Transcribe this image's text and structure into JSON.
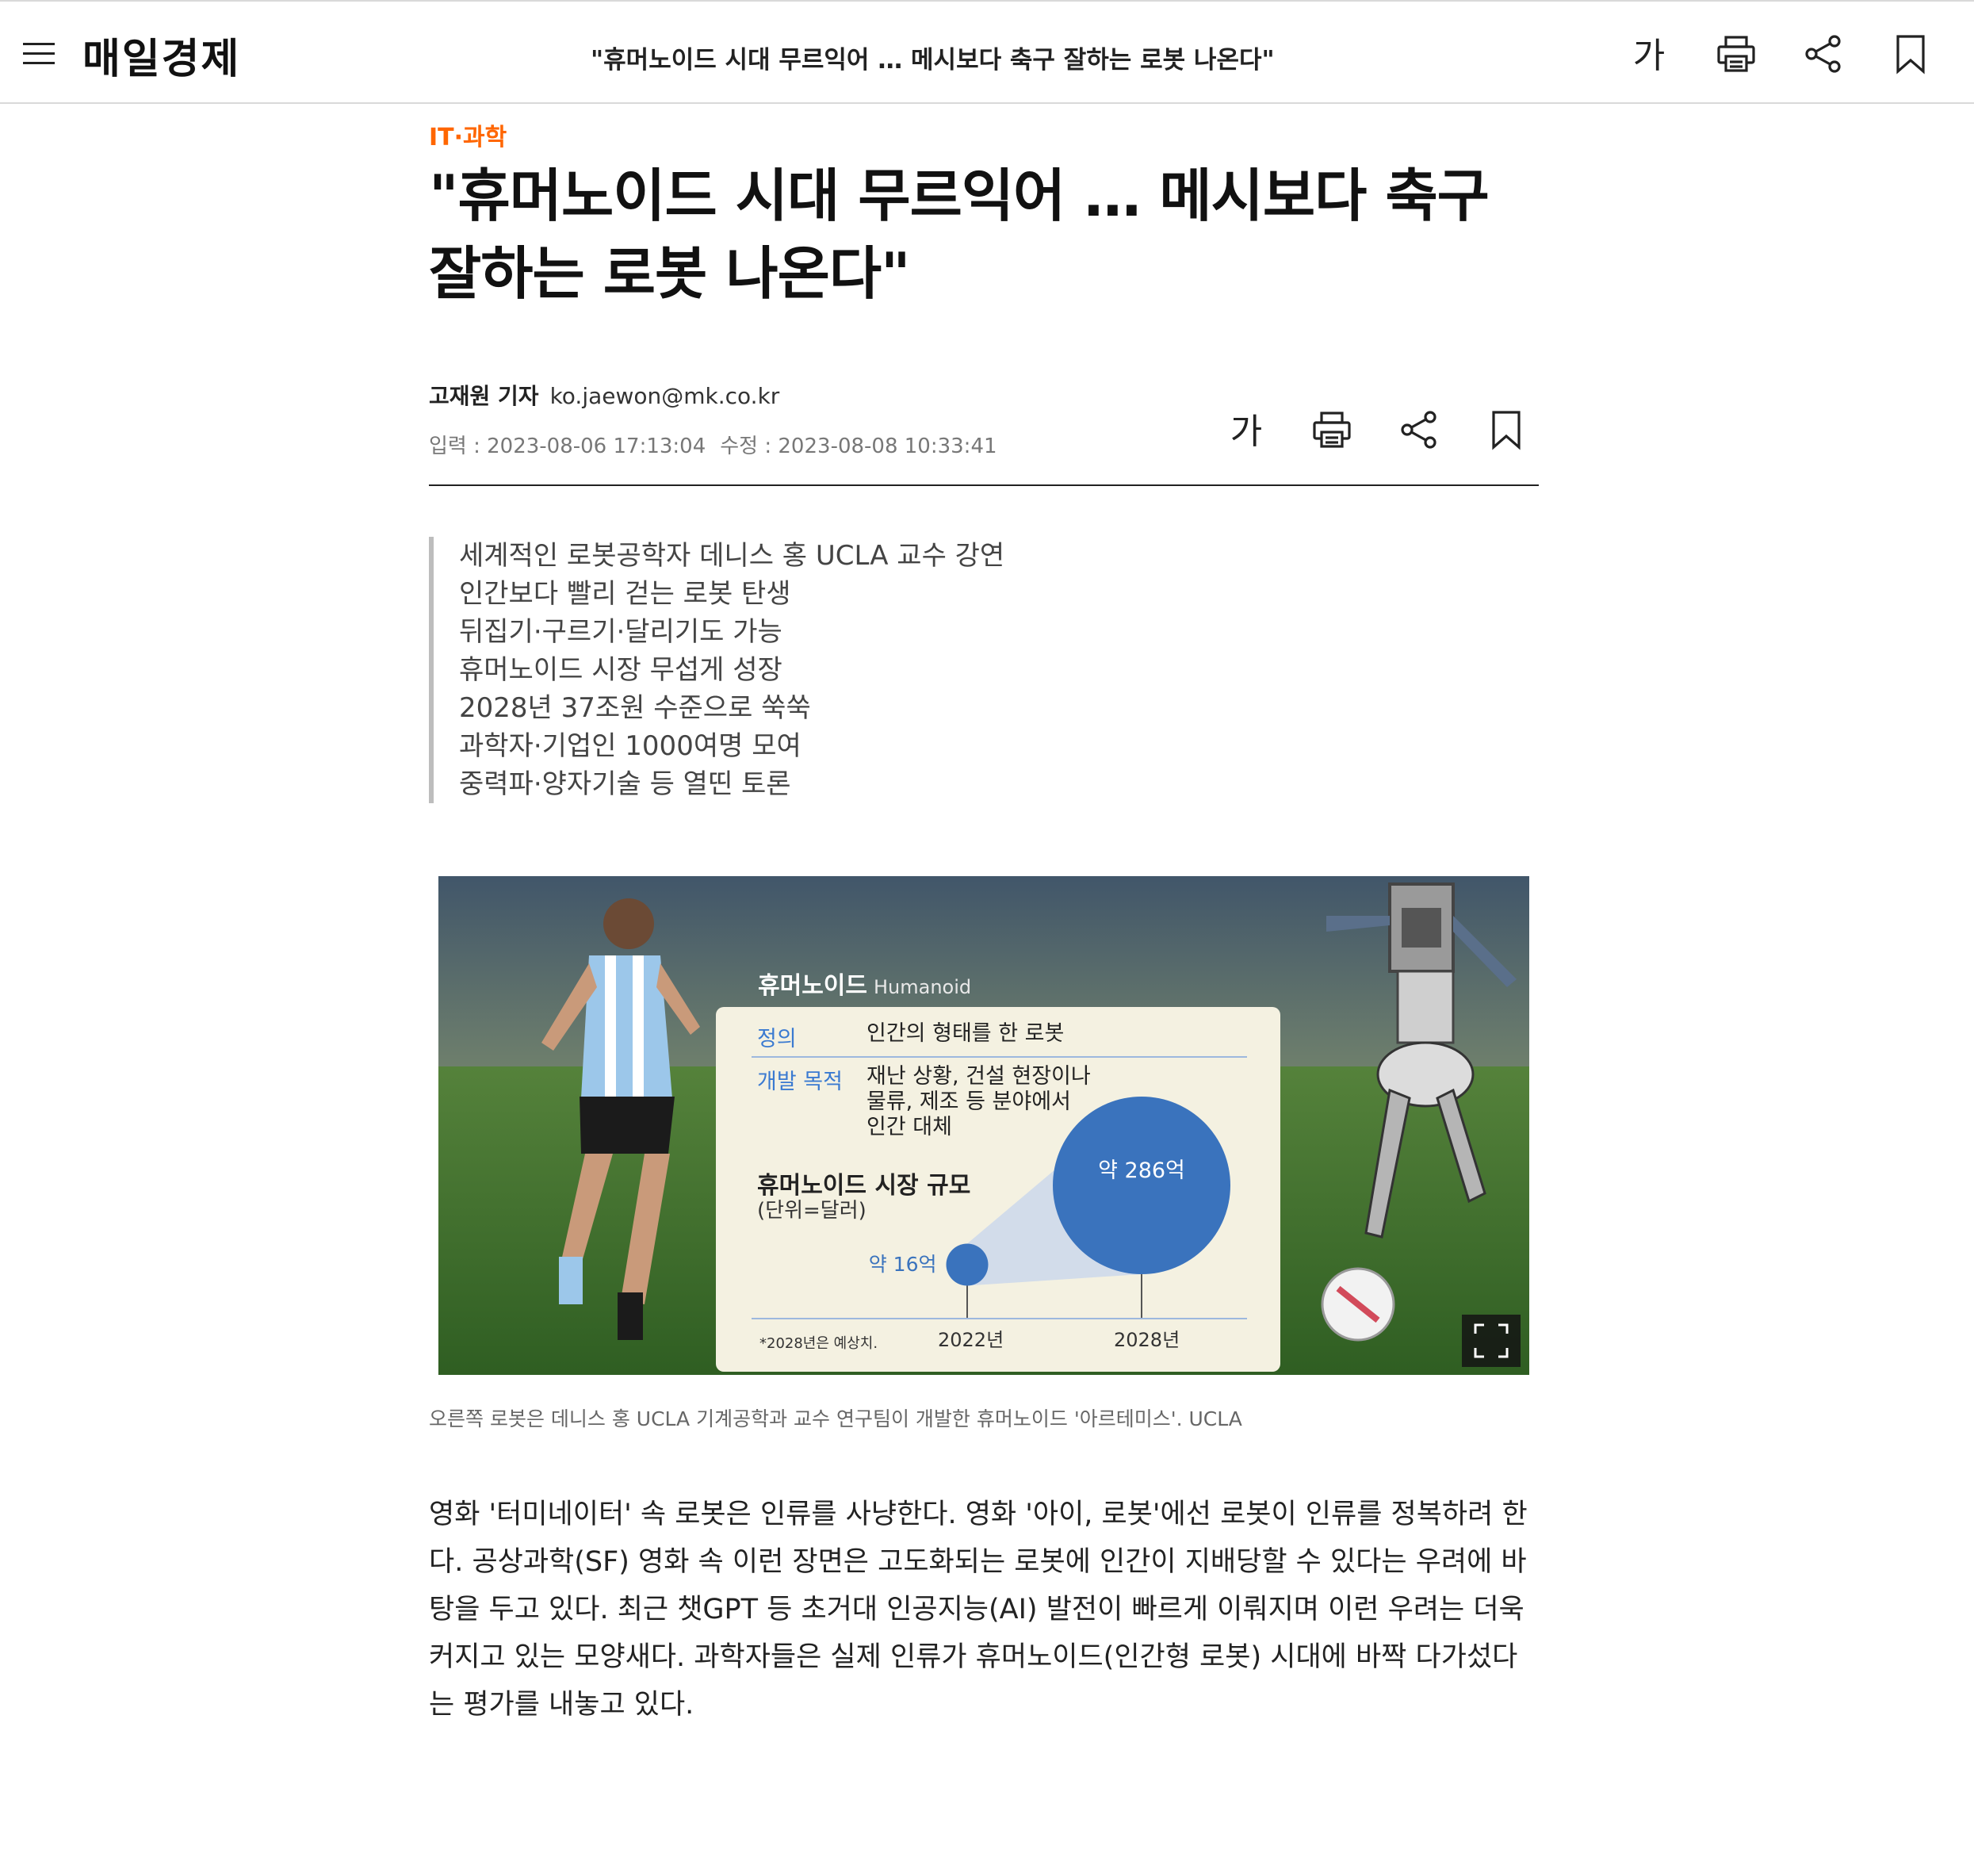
{
  "header": {
    "logo": "매일경제",
    "title": "\"휴머노이드 시대 무르익어 … 메시보다 축구 잘하는 로봇 나온다\"",
    "font_label": "가"
  },
  "article": {
    "category": "IT·과학",
    "headline_line1": "\"휴머노이드 시대 무르익어 … 메시보다 축구",
    "headline_line2": "잘하는 로봇 나온다\"",
    "author_name": "고재원 기자",
    "author_email": "ko.jaewon@mk.co.kr",
    "input_date": "입력 : 2023-08-06 17:13:04",
    "modified_date": "수정 : 2023-08-08 10:33:41",
    "font_label": "가",
    "summary": [
      "세계적인 로봇공학자 데니스 홍 UCLA 교수 강연",
      "인간보다 빨리 걷는 로봇 탄생",
      "뒤집기·구르기·달리기도 가능",
      "휴머노이드 시장 무섭게 성장",
      "2028년 37조원 수준으로 쑥쑥",
      "과학자·기업인 1000여명 모여",
      "중력파·양자기술 등 열띤 토론"
    ],
    "infographic": {
      "title": "휴머노이드",
      "title_en": "Humanoid",
      "def_label": "정의",
      "def_text": "인간의 형태를 한 로봇",
      "purpose_label": "개발 목적",
      "purpose_lines": [
        "재난 상황, 건설 현장이나",
        "물류, 제조 등 분야에서",
        "인간 대체"
      ],
      "market_title": "휴머노이드 시장 규모",
      "market_unit": "(단위=달러)",
      "note": "*2028년은 예상치.",
      "small_label": "약 16억",
      "big_label": "약 286억",
      "year1": "2022년",
      "year2": "2028년",
      "market_values": [
        16,
        286
      ],
      "circle_color": "#3a73bd"
    },
    "caption": "오른쪽 로봇은 데니스 홍 UCLA 기계공학과 교수 연구팀이 개발한 휴머노이드 '아르테미스'. UCLA",
    "body_lines": [
      "영화 '터미네이터' 속 로봇은 인류를 사냥한다. 영화 '아이, 로봇'에선 로봇이 인류를 정복하려 한",
      "다. 공상과학(SF) 영화 속 이런 장면은 고도화되는 로봇에 인간이 지배당할 수 있다는 우려에 바",
      "탕을 두고 있다. 최근 챗GPT 등 초거대 인공지능(AI) 발전이 빠르게 이뤄지며 이런 우려는 더욱",
      "커지고 있는 모양새다. 과학자들은 실제 인류가 휴머노이드(인간형 로봇) 시대에 바짝 다가섰다",
      "는 평가를 내놓고 있다."
    ]
  },
  "colors": {
    "accent": "#ff6600",
    "chart_blue": "#3a73bd"
  },
  "icons": [
    "menu-icon",
    "font-size-icon",
    "print-icon",
    "share-icon",
    "bookmark-icon",
    "expand-icon"
  ]
}
